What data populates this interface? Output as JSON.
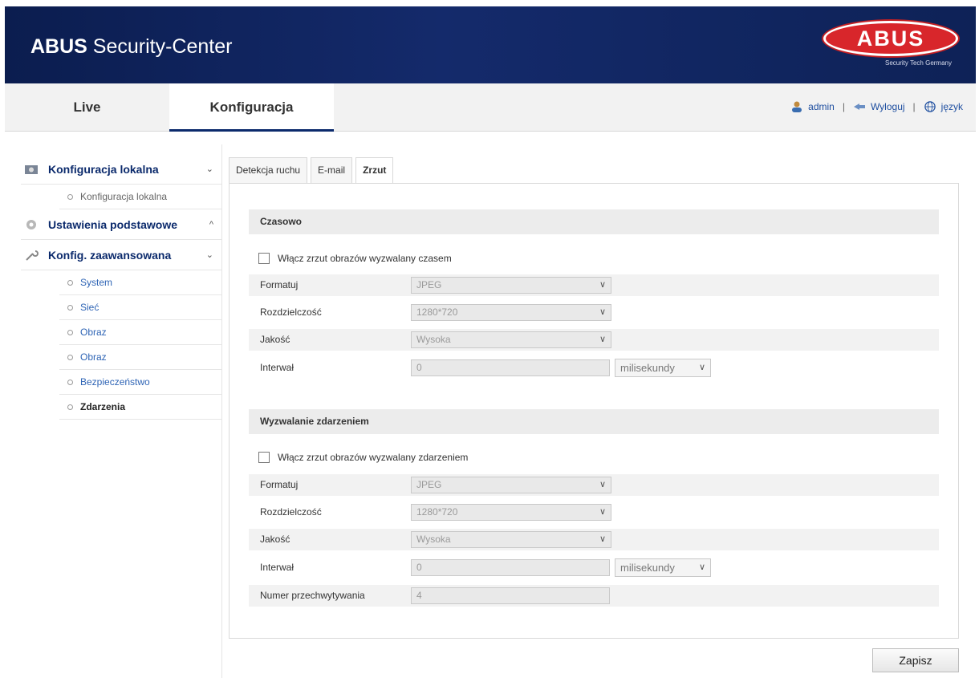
{
  "header": {
    "title_bold": "ABUS",
    "title_rest": " Security-Center",
    "logo_text": "ABUS",
    "logo_tagline": "Security Tech Germany"
  },
  "nav": {
    "live": "Live",
    "config": "Konfiguracja",
    "user": "admin",
    "logout": "Wyloguj",
    "language": "język"
  },
  "sidebar": {
    "local": {
      "label": "Konfiguracja lokalna",
      "chevron": "⌄",
      "items": [
        "Konfiguracja lokalna"
      ]
    },
    "basic": {
      "label": "Ustawienia podstawowe",
      "chevron": "^"
    },
    "advanced": {
      "label": "Konfig. zaawansowana",
      "chevron": "⌄",
      "items": [
        "System",
        "Sieć",
        "Obraz",
        "Obraz",
        "Bezpieczeństwo",
        "Zdarzenia"
      ]
    }
  },
  "tabs": [
    "Detekcja ruchu",
    "E-mail",
    "Zrzut"
  ],
  "timed": {
    "heading": "Czasowo",
    "checkbox": "Włącz zrzut obrazów wyzwalany czasem",
    "format_label": "Formatuj",
    "format_value": "JPEG",
    "resolution_label": "Rozdzielczość",
    "resolution_value": "1280*720",
    "quality_label": "Jakość",
    "quality_value": "Wysoka",
    "interval_label": "Interwał",
    "interval_value": "0",
    "interval_unit": "milisekundy"
  },
  "event": {
    "heading": "Wyzwalanie zdarzeniem",
    "checkbox": "Włącz zrzut obrazów wyzwalany zdarzeniem",
    "format_label": "Formatuj",
    "format_value": "JPEG",
    "resolution_label": "Rozdzielczość",
    "resolution_value": "1280*720",
    "quality_label": "Jakość",
    "quality_value": "Wysoka",
    "interval_label": "Interwał",
    "interval_value": "0",
    "interval_unit": "milisekundy",
    "capture_label": "Numer przechwytywania",
    "capture_value": "4"
  },
  "save_label": "Zapisz",
  "colors": {
    "header": "#0b1d4f",
    "accent": "#0b2a6c",
    "logo": "#d8262b"
  }
}
